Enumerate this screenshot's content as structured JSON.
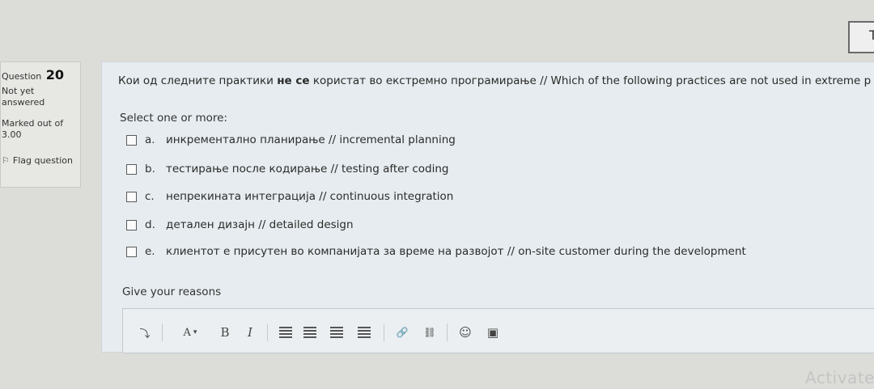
{
  "top_widget": {
    "glyph": "T"
  },
  "info": {
    "question_label": "Question",
    "question_number": "20",
    "status_line1": "Not yet",
    "status_line2": "answered",
    "marked_line1": "Marked out of",
    "marked_line2": "3.00",
    "flag_label": "Flag question",
    "flag_icon": "flag-icon"
  },
  "question": {
    "text_before": "Кои од следните практики ",
    "text_bold": "не се",
    "text_after": " користат во екстремно програмирање // Which of the following practices are not used in extreme p",
    "prompt": "Select one or more:",
    "options": [
      {
        "letter": "a.",
        "text": "инкрементално планирање // incremental planning"
      },
      {
        "letter": "b.",
        "text": "тестирање после кодирање // testing after coding"
      },
      {
        "letter": "c.",
        "text": "непрекината интеграција // continuous integration"
      },
      {
        "letter": "d.",
        "text": "детален дизајн // detailed design"
      },
      {
        "letter": "e.",
        "text": "клиентот е присутен во компанијата за време на развојот // on-site customer during the development"
      }
    ]
  },
  "reasons_label": "Give your reasons",
  "toolbar": {
    "expand": "⤵",
    "font_color": "A",
    "font_caret": "▾",
    "bold": "B",
    "italic": "I",
    "link": "🔗",
    "unlink": "⛓",
    "emoticon": "☺",
    "image": "▣"
  },
  "watermark": "Activate"
}
